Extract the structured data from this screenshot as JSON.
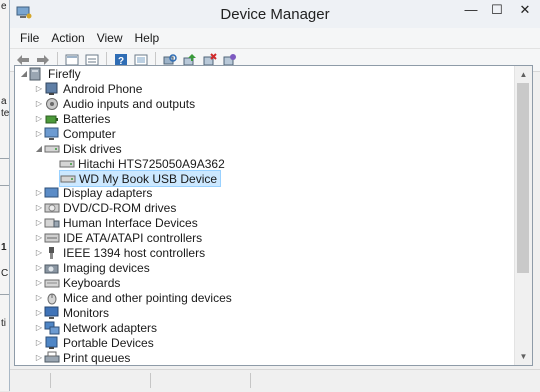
{
  "background_window": {
    "marks": [
      "e",
      "a",
      "te",
      "1",
      "C",
      "ti"
    ]
  },
  "window": {
    "title": "Device Manager",
    "controls": {
      "minimize": "—",
      "maximize": "☐",
      "close": "✕"
    }
  },
  "menu": [
    "File",
    "Action",
    "View",
    "Help"
  ],
  "toolbar_icons": [
    "back-arrow-icon",
    "forward-arrow-icon",
    "computer-view-icon",
    "properties-icon",
    "help-icon",
    "show-hidden-icon",
    "scan-hardware-icon",
    "update-driver-icon",
    "uninstall-icon",
    "disable-device-icon"
  ],
  "tree": {
    "root": "Firefly",
    "items": [
      {
        "label": "Android Phone",
        "icon": "phone-icon",
        "expanded": false
      },
      {
        "label": "Audio inputs and outputs",
        "icon": "audio-icon",
        "expanded": false
      },
      {
        "label": "Batteries",
        "icon": "battery-icon",
        "expanded": false
      },
      {
        "label": "Computer",
        "icon": "computer-icon",
        "expanded": false
      },
      {
        "label": "Disk drives",
        "icon": "disk-drive-icon",
        "expanded": true,
        "children": [
          "Hitachi HTS725050A9A362",
          "WD My Book USB Device"
        ]
      },
      {
        "label": "Display adapters",
        "icon": "display-adapter-icon",
        "expanded": false
      },
      {
        "label": "DVD/CD-ROM drives",
        "icon": "dvd-drive-icon",
        "expanded": false
      },
      {
        "label": "Human Interface Devices",
        "icon": "hid-icon",
        "expanded": false
      },
      {
        "label": "IDE ATA/ATAPI controllers",
        "icon": "ide-controller-icon",
        "expanded": false
      },
      {
        "label": "IEEE 1394 host controllers",
        "icon": "firewire-icon",
        "expanded": false
      },
      {
        "label": "Imaging devices",
        "icon": "camera-icon",
        "expanded": false
      },
      {
        "label": "Keyboards",
        "icon": "keyboard-icon",
        "expanded": false
      },
      {
        "label": "Mice and other pointing devices",
        "icon": "mouse-icon",
        "expanded": false
      },
      {
        "label": "Monitors",
        "icon": "monitor-icon",
        "expanded": false
      },
      {
        "label": "Network adapters",
        "icon": "network-adapter-icon",
        "expanded": false
      },
      {
        "label": "Portable Devices",
        "icon": "portable-device-icon",
        "expanded": false
      },
      {
        "label": "Print queues",
        "icon": "printer-icon",
        "expanded": false
      }
    ],
    "selected": "WD My Book USB Device"
  },
  "colors": {
    "selection_bg": "#cce8ff",
    "selection_border": "#99d1ff",
    "help_blue": "#2f6db5"
  }
}
